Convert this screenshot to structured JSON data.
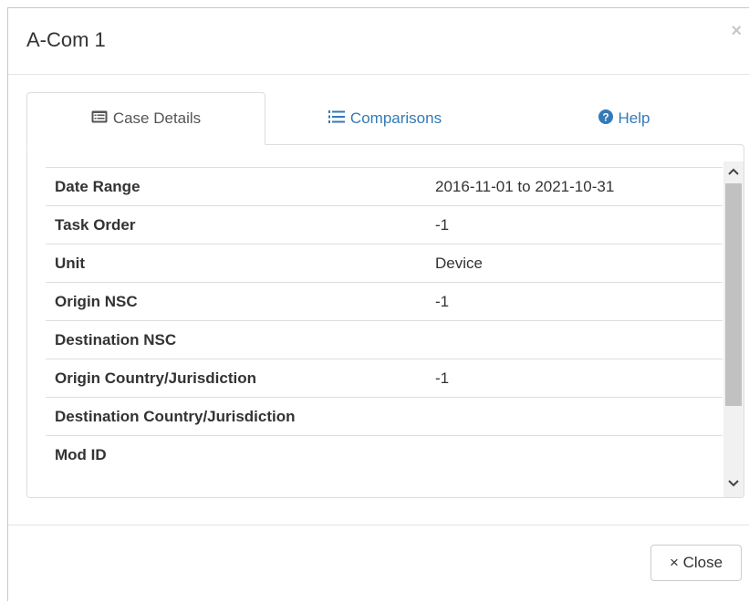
{
  "modal": {
    "title": "A-Com 1",
    "close_x": "×"
  },
  "tabs": [
    {
      "label": "Case Details",
      "icon": "list-alt-icon"
    },
    {
      "label": "Comparisons",
      "icon": "list-ol-icon"
    },
    {
      "label": "Help",
      "icon": "question-circle-icon"
    }
  ],
  "details": [
    {
      "label": "Date Range",
      "value": "2016-11-01 to 2021-10-31"
    },
    {
      "label": "Task Order",
      "value": "-1"
    },
    {
      "label": "Unit",
      "value": "Device"
    },
    {
      "label": "Origin NSC",
      "value": "-1"
    },
    {
      "label": "Destination NSC",
      "value": ""
    },
    {
      "label": "Origin Country/Jurisdiction",
      "value": "-1"
    },
    {
      "label": "Destination Country/Jurisdiction",
      "value": ""
    },
    {
      "label": "Mod ID",
      "value": ""
    }
  ],
  "footer": {
    "close_label": "× Close"
  },
  "colors": {
    "link": "#337ab7",
    "border": "#dddddd"
  }
}
